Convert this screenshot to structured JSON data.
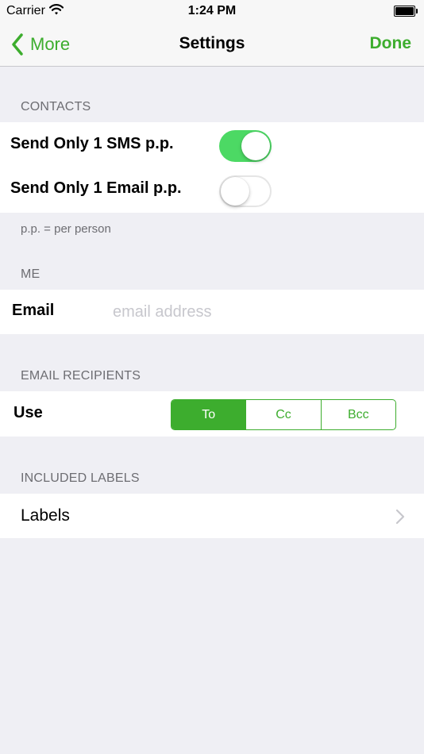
{
  "status_bar": {
    "carrier": "Carrier",
    "time": "1:24 PM"
  },
  "nav_bar": {
    "back_label": "More",
    "title": "Settings",
    "done_label": "Done"
  },
  "colors": {
    "accent": "#3dad2e",
    "switch_on": "#4cd964",
    "background": "#efeff4",
    "section_text": "#6d6d72",
    "placeholder": "#c7c7cd"
  },
  "contacts": {
    "header": "CONTACTS",
    "rows": [
      {
        "label": "Send Only 1 SMS p.p.",
        "on": true
      },
      {
        "label": "Send Only 1 Email p.p.",
        "on": false
      }
    ],
    "footer": "p.p. = per person"
  },
  "me": {
    "header": "ME",
    "email_label": "Email",
    "email_value": "",
    "email_placeholder": "email address"
  },
  "email_recipients": {
    "header": "EMAIL RECIPIENTS",
    "use_label": "Use",
    "options": [
      "To",
      "Cc",
      "Bcc"
    ],
    "selected": "To"
  },
  "included_labels": {
    "header": "INCLUDED LABELS",
    "row_label": "Labels"
  },
  "icons": {
    "wifi": "wifi-icon",
    "battery": "battery-icon",
    "back": "chevron-left-icon",
    "disclosure": "chevron-right-icon"
  }
}
